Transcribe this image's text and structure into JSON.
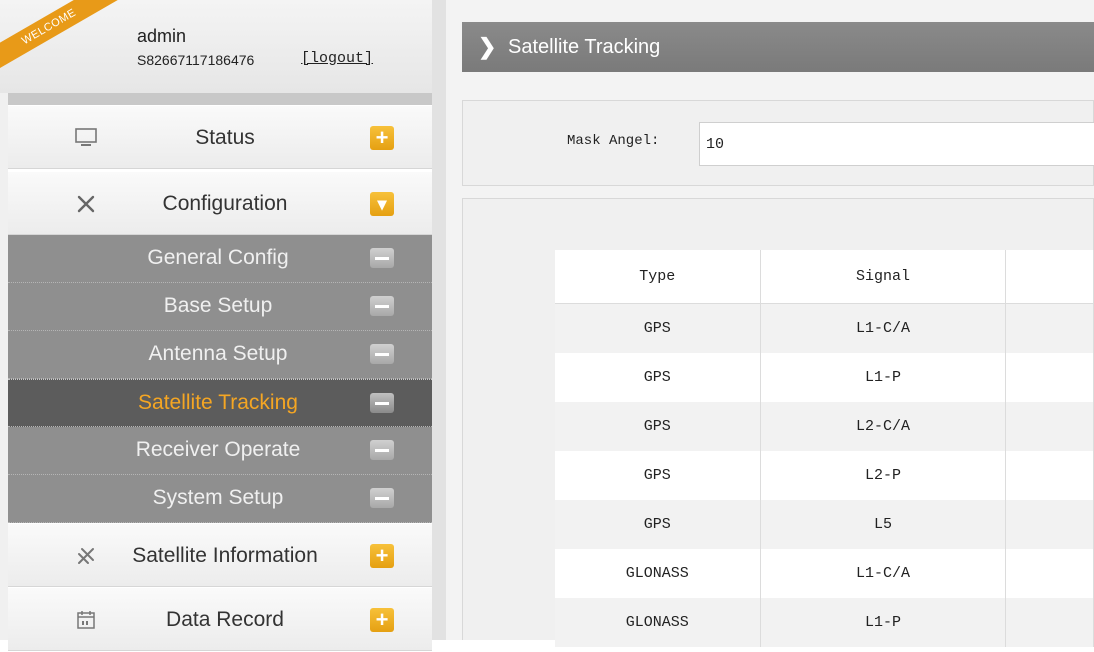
{
  "user": {
    "ribbon": "WELCOME",
    "name": "admin",
    "serial": "S82667117186476",
    "logout": "[logout]"
  },
  "menu": {
    "status": {
      "label": "Status",
      "icon": "monitor-icon",
      "toggle": "+"
    },
    "configuration": {
      "label": "Configuration",
      "icon": "tools-icon",
      "toggle": "▾"
    },
    "sub_items": [
      {
        "label": "General Config"
      },
      {
        "label": "Base Setup"
      },
      {
        "label": "Antenna Setup"
      },
      {
        "label": "Satellite Tracking",
        "active": true
      },
      {
        "label": "Receiver Operate"
      },
      {
        "label": "System Setup"
      }
    ],
    "satellite_information": {
      "label": "Satellite Information",
      "icon": "satellite-icon",
      "toggle": "+"
    },
    "data_record": {
      "label": "Data Record",
      "icon": "calendar-icon",
      "toggle": "+"
    }
  },
  "page": {
    "title": "Satellite Tracking",
    "mask_label": "Mask Angel:",
    "mask_value": "10"
  },
  "table": {
    "headers": [
      "Type",
      "Signal",
      ""
    ],
    "rows": [
      [
        "GPS",
        "L1-C/A"
      ],
      [
        "GPS",
        "L1-P"
      ],
      [
        "GPS",
        "L2-C/A"
      ],
      [
        "GPS",
        "L2-P"
      ],
      [
        "GPS",
        "L5"
      ],
      [
        "GLONASS",
        "L1-C/A"
      ],
      [
        "GLONASS",
        "L1-P"
      ]
    ]
  },
  "colors": {
    "accent": "#f5a623",
    "title_bar": "#808080",
    "submenu_bg": "#8f8f8f",
    "submenu_active_bg": "#5c5c5c"
  }
}
